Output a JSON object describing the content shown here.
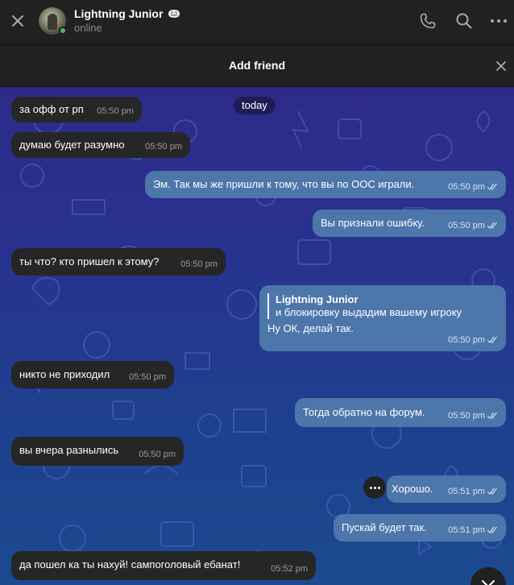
{
  "header": {
    "contact_name": "Lightning Junior",
    "status": "online",
    "icons": [
      "close-icon",
      "phone-icon",
      "search-icon",
      "more-icon"
    ]
  },
  "banner": {
    "label": "Add friend"
  },
  "chat": {
    "day_label": "today",
    "messages": [
      {
        "dir": "in",
        "text": "за офф от рп",
        "time": "05:50 pm"
      },
      {
        "dir": "in",
        "text": "думаю будет разумно",
        "time": "05:50 pm"
      },
      {
        "dir": "out",
        "text": "Эм. Так мы же пришли к тому, что вы по ООС играли.",
        "time": "05:50 pm"
      },
      {
        "dir": "out",
        "text": "Вы признали ошибку.",
        "time": "05:50 pm"
      },
      {
        "dir": "in",
        "text": "ты что? кто пришел к этому?",
        "time": "05:50 pm"
      },
      {
        "dir": "out",
        "reply_name": "Lightning Junior",
        "reply_text": "и блокировку выдадим вашему игроку",
        "text": "Ну ОК, делай так.",
        "time": "05:50 pm"
      },
      {
        "dir": "in",
        "text": "никто не приходил",
        "time": "05:50 pm"
      },
      {
        "dir": "out",
        "text": "Тогда обратно на форум.",
        "time": "05:50 pm"
      },
      {
        "dir": "in",
        "text": "вы вчера разнылись",
        "time": "05:50 pm"
      },
      {
        "dir": "out",
        "text": "Хорошо.",
        "time": "05:51 pm"
      },
      {
        "dir": "out",
        "text": "Пускай будет так.",
        "time": "05:51 pm"
      },
      {
        "dir": "in",
        "text": "да пошел ка ты нахуй! сампоголовый ебанат!",
        "time": "05:52 pm"
      }
    ]
  },
  "colors": {
    "incoming_bubble": "#262626",
    "outgoing_bubble": "#4d76ab",
    "online": "#4fbd5f",
    "header_bg": "#212121"
  }
}
